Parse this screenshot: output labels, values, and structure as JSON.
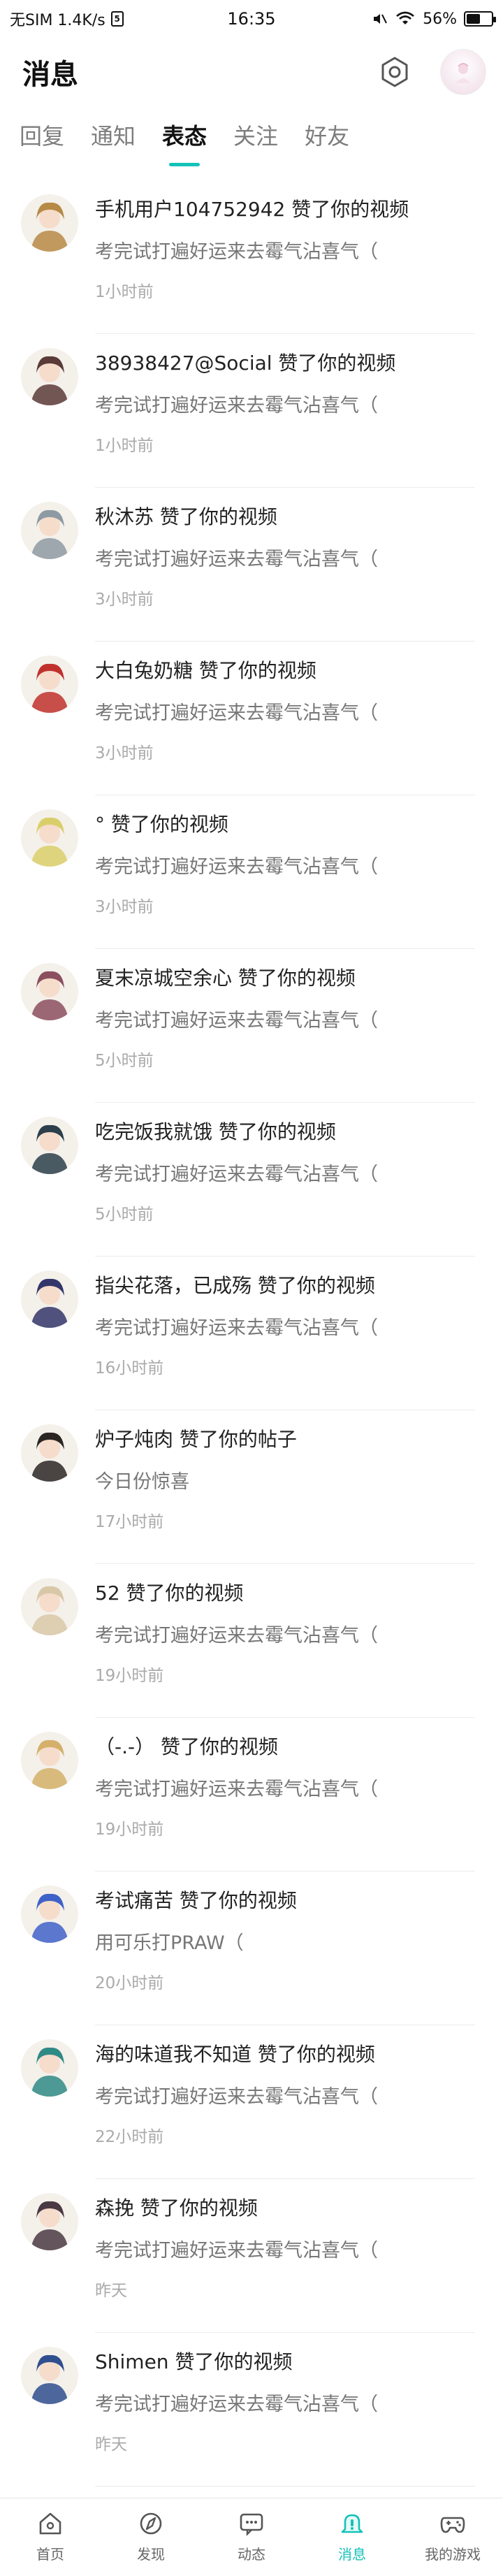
{
  "status_bar": {
    "left": "无SIM 1.4K/s",
    "time": "16:35",
    "battery": "56%",
    "battery_level": 0.56
  },
  "header": {
    "title": "消息"
  },
  "tabs": [
    "回复",
    "通知",
    "表态",
    "关注",
    "好友"
  ],
  "active_tab": "表态",
  "notifications": [
    {
      "title": "手机用户104752942 赞了你的视频",
      "content": "考完试打遍好运来去霉气沾喜气（",
      "time": "1小时前",
      "avatar_color": "#b78a46"
    },
    {
      "title": "38938427@Social 赞了你的视频",
      "content": "考完试打遍好运来去霉气沾喜气（",
      "time": "1小时前",
      "avatar_color": "#5a3b39"
    },
    {
      "title": "秋沐苏 赞了你的视频",
      "content": "考完试打遍好运来去霉气沾喜气（",
      "time": "3小时前",
      "avatar_color": "#8e9aa3"
    },
    {
      "title": "大白兔奶糖 赞了你的视频",
      "content": "考完试打遍好运来去霉气沾喜气（",
      "time": "3小时前",
      "avatar_color": "#c0312e"
    },
    {
      "title": "° 赞了你的视频",
      "content": "考完试打遍好运来去霉气沾喜气（",
      "time": "3小时前",
      "avatar_color": "#d9cf6a"
    },
    {
      "title": "夏末凉城空余心 赞了你的视频",
      "content": "考完试打遍好运来去霉气沾喜气（",
      "time": "5小时前",
      "avatar_color": "#8c4f5f"
    },
    {
      "title": "吃完饭我就饿 赞了你的视频",
      "content": "考完试打遍好运来去霉气沾喜气（",
      "time": "5小时前",
      "avatar_color": "#2c3f4b"
    },
    {
      "title": "指尖花落，已成殇 赞了你的视频",
      "content": "考完试打遍好运来去霉气沾喜气（",
      "time": "16小时前",
      "avatar_color": "#33366a"
    },
    {
      "title": "炉子炖肉 赞了你的帖子",
      "content": "今日份惊喜",
      "time": "17小时前",
      "avatar_color": "#2b2624"
    },
    {
      "title": "52 赞了你的视频",
      "content": "考完试打遍好运来去霉气沾喜气（",
      "time": "19小时前",
      "avatar_color": "#d9c8a8"
    },
    {
      "title": "（-.-） 赞了你的视频",
      "content": "考完试打遍好运来去霉气沾喜气（",
      "time": "19小时前",
      "avatar_color": "#d4b06a"
    },
    {
      "title": "考试痛苦 赞了你的视频",
      "content": "用可乐打PRAW（",
      "time": "20小时前",
      "avatar_color": "#3f62c9"
    },
    {
      "title": "海的味道我不知道 赞了你的视频",
      "content": "考完试打遍好运来去霉气沾喜气（",
      "time": "22小时前",
      "avatar_color": "#2f8a86"
    },
    {
      "title": "森挽 赞了你的视频",
      "content": "考完试打遍好运来去霉气沾喜气（",
      "time": "昨天",
      "avatar_color": "#4a3a44"
    },
    {
      "title": "Shimen 赞了你的视频",
      "content": "考完试打遍好运来去霉气沾喜气（",
      "time": "昨天",
      "avatar_color": "#2f4f8f"
    }
  ],
  "bottom_nav": [
    {
      "label": "首页",
      "icon": "home-icon"
    },
    {
      "label": "发现",
      "icon": "discover-icon"
    },
    {
      "label": "动态",
      "icon": "feed-icon"
    },
    {
      "label": "消息",
      "icon": "bell-icon"
    },
    {
      "label": "我的游戏",
      "icon": "gamepad-icon"
    }
  ],
  "colors": {
    "accent": "#14c2b8",
    "text": "#222222",
    "muted": "#777777"
  }
}
